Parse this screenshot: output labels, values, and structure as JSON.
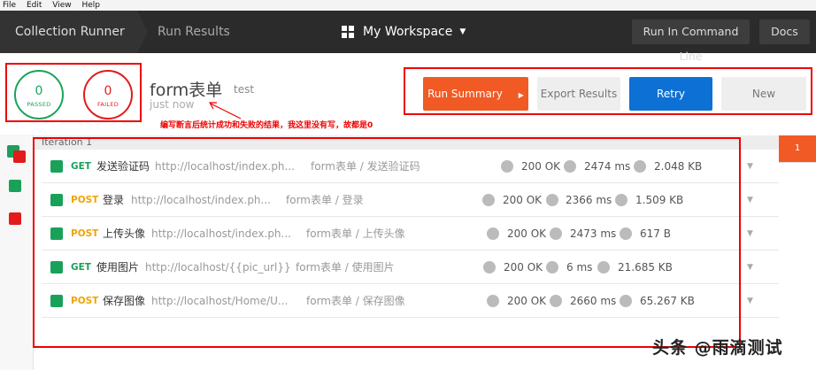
{
  "menu": [
    "File",
    "Edit",
    "View",
    "Help"
  ],
  "header": {
    "crumb_runner": "Collection Runner",
    "crumb_results": "Run Results",
    "workspace": "My Workspace",
    "run_cmd": "Run In Command Line",
    "docs": "Docs"
  },
  "stats": {
    "passed_count": "0",
    "passed_label": "PASSED",
    "failed_count": "0",
    "failed_label": "FAILED"
  },
  "run": {
    "name": "form表单",
    "environment": "test",
    "time": "just now",
    "annotation": "编写断言后统计成功和失败的结果，我这里没有写，故都是0"
  },
  "actions": {
    "summary": "Run Summary",
    "export": "Export Results",
    "retry": "Retry",
    "new": "New"
  },
  "iteration": {
    "label": "Iteration 1",
    "tab": "1"
  },
  "requests": [
    {
      "method": "GET",
      "name": "发送验证码",
      "url": "http://localhost/index.ph...",
      "folder": "form表单 / 发送验证码",
      "status": "200 OK",
      "time": "2474 ms",
      "size": "2.048 KB"
    },
    {
      "method": "POST",
      "name": "登录",
      "url": "http://localhost/index.ph...",
      "folder": "form表单 / 登录",
      "status": "200 OK",
      "time": "2366 ms",
      "size": "1.509 KB"
    },
    {
      "method": "POST",
      "name": "上传头像",
      "url": "http://localhost/index.ph...",
      "folder": "form表单 / 上传头像",
      "status": "200 OK",
      "time": "2473 ms",
      "size": "617 B"
    },
    {
      "method": "GET",
      "name": "使用图片",
      "url": "http://localhost/{{pic_url}}",
      "folder": "form表单 / 使用图片",
      "status": "200 OK",
      "time": "6 ms",
      "size": "21.685 KB"
    },
    {
      "method": "POST",
      "name": "保存图像",
      "url": "http://localhost/Home/U...",
      "folder": "form表单 / 保存图像",
      "status": "200 OK",
      "time": "2660 ms",
      "size": "65.267 KB"
    }
  ],
  "watermark": "头条 @雨滴测试",
  "colors": {
    "pass": "#1aa35b",
    "fail": "#e21b1b",
    "accent": "#f15a24",
    "retry": "#0d70d4"
  }
}
